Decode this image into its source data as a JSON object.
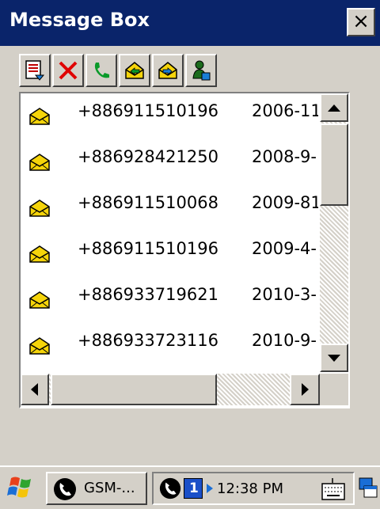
{
  "window": {
    "title": "Message Box",
    "close_label": "×"
  },
  "toolbar": {
    "buttons": [
      {
        "name": "new-message",
        "icon": "compose-icon"
      },
      {
        "name": "delete",
        "icon": "red-x-icon"
      },
      {
        "name": "call",
        "icon": "phone-icon"
      },
      {
        "name": "reply",
        "icon": "envelope-reply-icon"
      },
      {
        "name": "forward",
        "icon": "envelope-forward-icon"
      },
      {
        "name": "move",
        "icon": "person-save-icon"
      }
    ]
  },
  "messages": [
    {
      "number": "+886911510196",
      "date": "2006-11"
    },
    {
      "number": "+886928421250",
      "date": "2008-9-"
    },
    {
      "number": "+886911510068",
      "date": "2009-81"
    },
    {
      "number": "+886911510196",
      "date": "2009-4-"
    },
    {
      "number": "+886933719621",
      "date": "2010-3-"
    },
    {
      "number": "+886933723116",
      "date": "2010-9-"
    }
  ],
  "taskbar": {
    "task_label": "GSM-...",
    "signal_badge": "1",
    "clock": "12:38 PM"
  },
  "colors": {
    "titlebar": "#0a246a",
    "face": "#d4d0c8",
    "envelope": "#f5d40a"
  }
}
